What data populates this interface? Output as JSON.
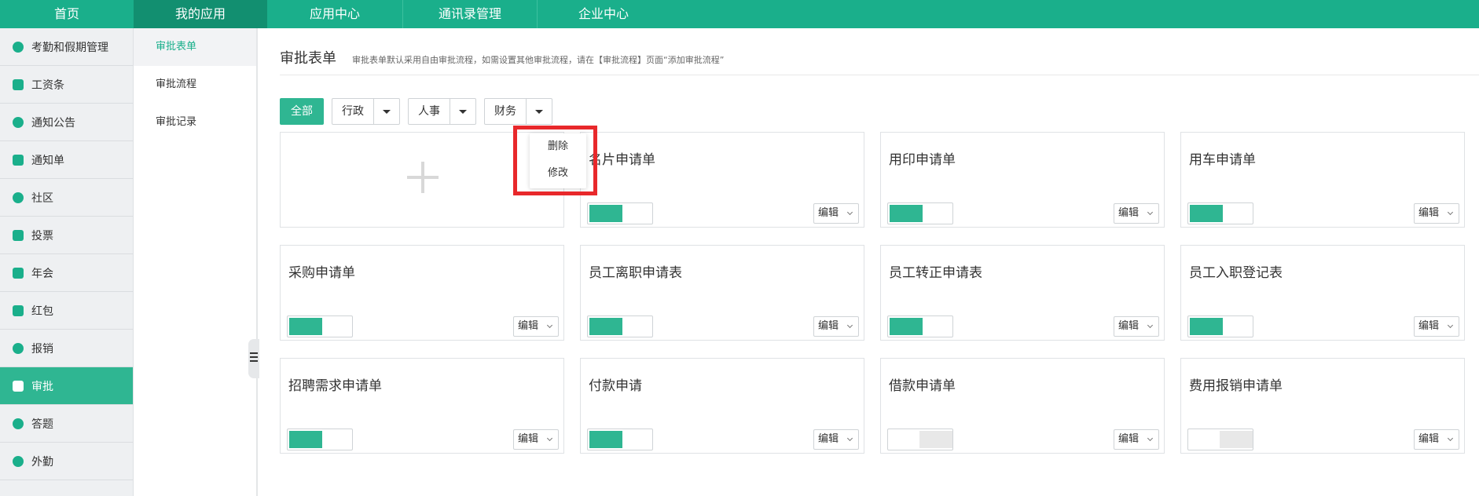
{
  "topnav": {
    "items": [
      "首页",
      "我的应用",
      "应用中心",
      "通讯录管理",
      "企业中心"
    ],
    "active_index": 1
  },
  "sidebar": {
    "items": [
      {
        "label": "考勤和假期管理",
        "icon": "hand-icon"
      },
      {
        "label": "工资条",
        "icon": "money-icon"
      },
      {
        "label": "通知公告",
        "icon": "bell-icon"
      },
      {
        "label": "通知单",
        "icon": "notice-icon"
      },
      {
        "label": "社区",
        "icon": "chat-icon"
      },
      {
        "label": "投票",
        "icon": "vote-icon"
      },
      {
        "label": "年会",
        "icon": "ticket-icon"
      },
      {
        "label": "红包",
        "icon": "red-packet-icon"
      },
      {
        "label": "报销",
        "icon": "yen-icon"
      },
      {
        "label": "审批",
        "icon": "stamp-icon"
      },
      {
        "label": "答题",
        "icon": "quiz-icon"
      },
      {
        "label": "外勤",
        "icon": "location-icon"
      }
    ],
    "active_index": 9
  },
  "submenu": {
    "items": [
      "审批表单",
      "审批流程",
      "审批记录"
    ],
    "active_index": 0
  },
  "main": {
    "title": "审批表单",
    "description": "审批表单默认采用自由审批流程，如需设置其他审批流程，请在【审批流程】页面“添加审批流程”",
    "filters": {
      "all_label": "全部",
      "groups": [
        "行政",
        "人事",
        "财务"
      ]
    },
    "dropdown": {
      "options": [
        "删除",
        "修改"
      ]
    },
    "edit_label": "编辑",
    "cards": [
      {
        "title": "名片申请单",
        "enabled": true
      },
      {
        "title": "用印申请单",
        "enabled": true
      },
      {
        "title": "用车申请单",
        "enabled": true
      },
      {
        "title": "采购申请单",
        "enabled": true
      },
      {
        "title": "员工离职申请表",
        "enabled": true
      },
      {
        "title": "员工转正申请表",
        "enabled": true
      },
      {
        "title": "员工入职登记表",
        "enabled": true
      },
      {
        "title": "招聘需求申请单",
        "enabled": true
      },
      {
        "title": "付款申请",
        "enabled": true
      },
      {
        "title": "借款申请单",
        "enabled": false
      },
      {
        "title": "费用报销申请单",
        "enabled": false
      }
    ]
  },
  "colors": {
    "brand": "#1aaf8b",
    "brand_dark": "#128f70",
    "toggle_on": "#2fb692",
    "highlight": "#e8282b"
  }
}
